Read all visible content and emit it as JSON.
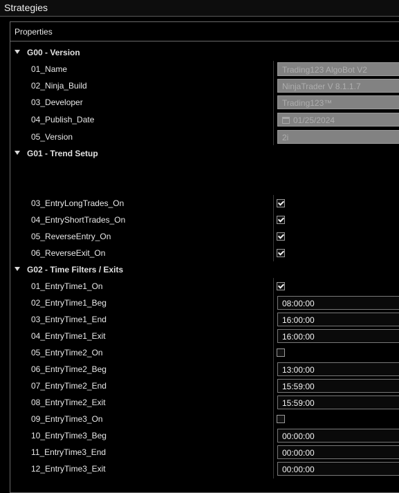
{
  "window": {
    "title": "Strategies"
  },
  "panel": {
    "title": "Properties"
  },
  "groups": [
    {
      "label": "G00 - Version",
      "props": [
        {
          "label": "01_Name",
          "kind": "readonly",
          "value": "Trading123 AlgoBot V2"
        },
        {
          "label": "02_Ninja_Build",
          "kind": "readonly",
          "value": "NinjaTrader V 8.1.1.7"
        },
        {
          "label": "03_Developer",
          "kind": "readonly",
          "value": "Trading123™"
        },
        {
          "label": "04_Publish_Date",
          "kind": "readonly-date",
          "value": "01/25/2024",
          "icon": "calendar-icon"
        },
        {
          "label": "05_Version",
          "kind": "readonly",
          "value": "2i"
        }
      ]
    },
    {
      "label": "G01 - Trend Setup",
      "props": [
        {
          "label": "03_EntryLongTrades_On",
          "kind": "checkbox",
          "checked": true
        },
        {
          "label": "04_EntryShortTrades_On",
          "kind": "checkbox",
          "checked": true
        },
        {
          "label": "05_ReverseEntry_On",
          "kind": "checkbox",
          "checked": true
        },
        {
          "label": "06_ReverseExit_On",
          "kind": "checkbox",
          "checked": true
        }
      ]
    },
    {
      "label": "G02 - Time Filters / Exits",
      "props": [
        {
          "label": "01_EntryTime1_On",
          "kind": "checkbox",
          "checked": true
        },
        {
          "label": "02_EntryTime1_Beg",
          "kind": "time",
          "value": "08:00:00"
        },
        {
          "label": "03_EntryTime1_End",
          "kind": "time",
          "value": "16:00:00"
        },
        {
          "label": "04_EntryTime1_Exit",
          "kind": "time",
          "value": "16:00:00"
        },
        {
          "label": "05_EntryTime2_On",
          "kind": "checkbox",
          "checked": false
        },
        {
          "label": "06_EntryTime2_Beg",
          "kind": "time",
          "value": "13:00:00"
        },
        {
          "label": "07_EntryTime2_End",
          "kind": "time",
          "value": "15:59:00"
        },
        {
          "label": "08_EntryTime2_Exit",
          "kind": "time",
          "value": "15:59:00"
        },
        {
          "label": "09_EntryTime3_On",
          "kind": "checkbox",
          "checked": false
        },
        {
          "label": "10_EntryTime3_Beg",
          "kind": "time",
          "value": "00:00:00"
        },
        {
          "label": "11_EntryTime3_End",
          "kind": "time",
          "value": "00:00:00"
        },
        {
          "label": "12_EntryTime3_Exit",
          "kind": "time",
          "value": "00:00:00"
        }
      ]
    }
  ]
}
